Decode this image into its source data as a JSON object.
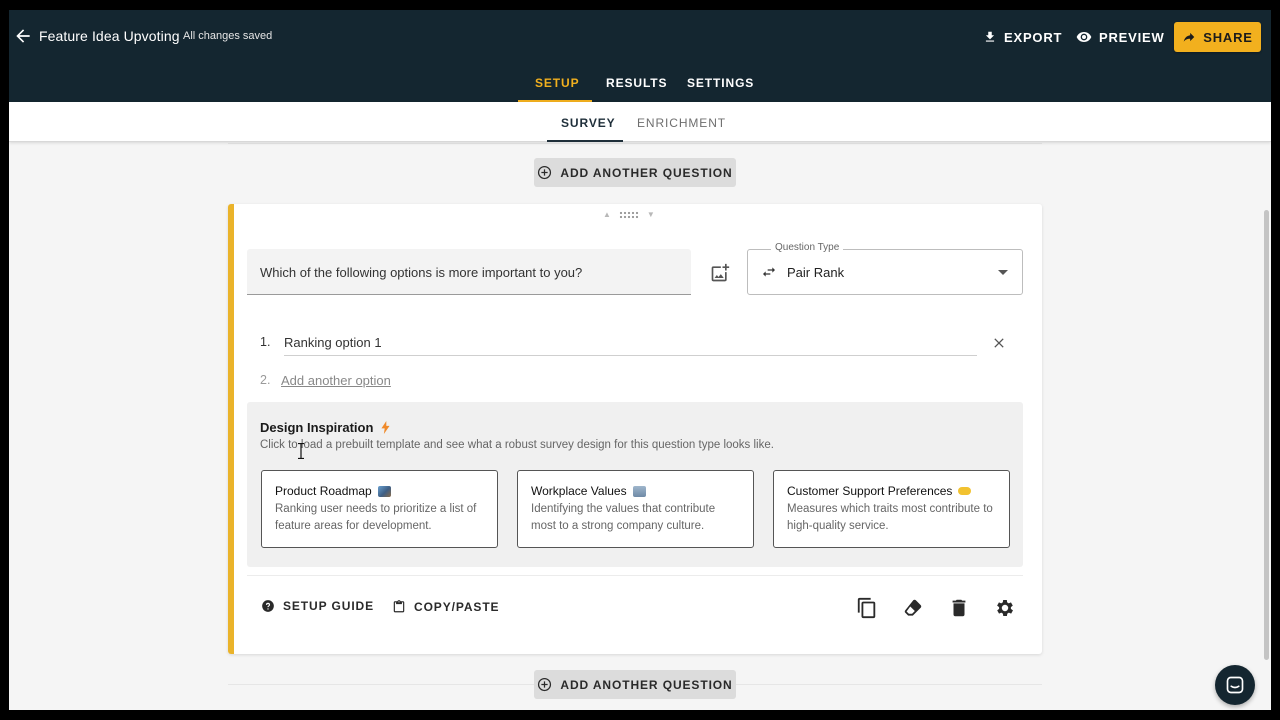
{
  "header": {
    "title": "Feature Idea Upvoting",
    "save_status": "All changes saved",
    "export_label": "EXPORT",
    "preview_label": "PREVIEW",
    "share_label": "SHARE"
  },
  "main_tabs": [
    "SETUP",
    "RESULTS",
    "SETTINGS"
  ],
  "sub_tabs": [
    "SURVEY",
    "ENRICHMENT"
  ],
  "add_question_label": "ADD ANOTHER QUESTION",
  "question": {
    "text": "Which of the following options is more important to you?",
    "type_legend": "Question Type",
    "type_value": "Pair Rank",
    "options": [
      {
        "num": "1.",
        "text": "Ranking option 1"
      }
    ],
    "add_option": {
      "num": "2.",
      "text": "Add another option"
    }
  },
  "inspiration": {
    "title": "Design Inspiration",
    "subtitle": "Click to load a prebuilt template and see what a robust survey design for this question type looks like.",
    "templates": [
      {
        "title": "Product Roadmap",
        "desc": "Ranking user needs to prioritize a list of feature areas for development.",
        "emoji_color": "#5a7fa8"
      },
      {
        "title": "Workplace Values",
        "desc": "Identifying the values that contribute most to a strong company culture.",
        "emoji_color": "#7a9bb8"
      },
      {
        "title": "Customer Support Preferences",
        "desc": "Measures which traits most contribute to high-quality service.",
        "emoji_color": "#f2c230"
      }
    ]
  },
  "footer": {
    "setup_guide": "SETUP GUIDE",
    "copy_paste": "COPY/PASTE"
  },
  "colors": {
    "accent": "#f2b01e",
    "topbar": "#142630"
  }
}
